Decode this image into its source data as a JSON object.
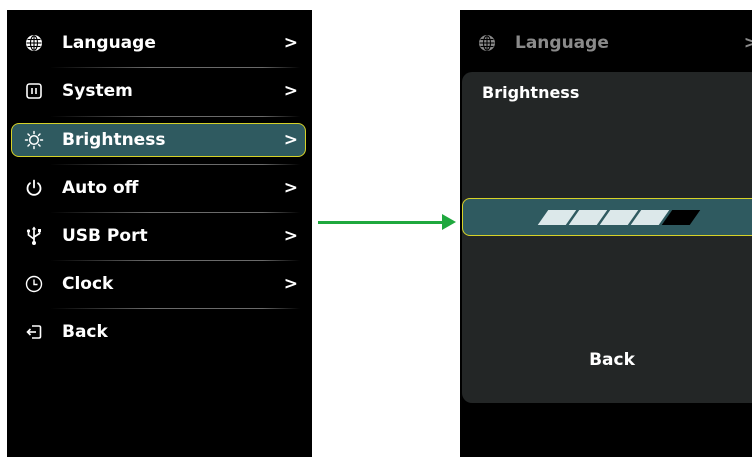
{
  "left_menu": {
    "items": [
      {
        "label": "Language",
        "icon": "globe-icon",
        "chevron": ">"
      },
      {
        "label": "System",
        "icon": "system-icon",
        "chevron": ">"
      },
      {
        "label": "Brightness",
        "icon": "sun-icon",
        "chevron": ">",
        "selected": true
      },
      {
        "label": "Auto off",
        "icon": "power-icon",
        "chevron": ">"
      },
      {
        "label": "USB Port",
        "icon": "usb-icon",
        "chevron": ">"
      },
      {
        "label": "Clock",
        "icon": "clock-icon",
        "chevron": ">"
      },
      {
        "label": "Back",
        "icon": "back-icon",
        "chevron": ""
      }
    ]
  },
  "right_screen": {
    "top_item": {
      "label": "Language",
      "icon": "globe-icon",
      "chevron": ">"
    },
    "panel_title": "Brightness",
    "brightness_level": 4,
    "brightness_max": 5,
    "back_label": "Back"
  },
  "colors": {
    "selection_fill": "#2f5a60",
    "selection_border": "#d6d228",
    "arrow": "#1fa83e"
  }
}
